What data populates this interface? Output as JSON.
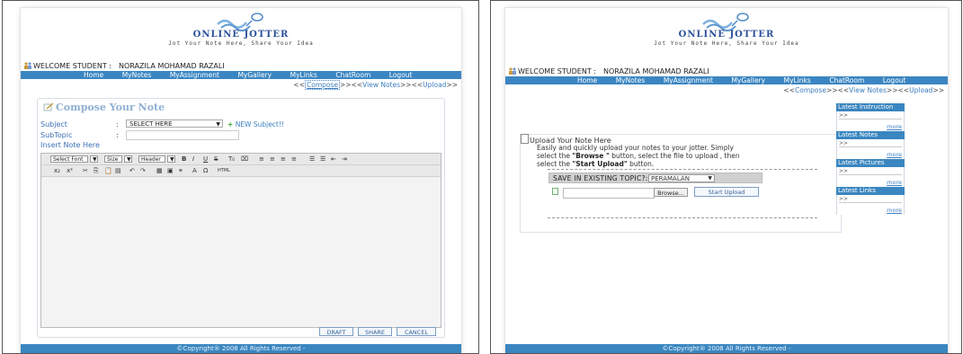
{
  "compose_page": {
    "logo": {
      "title": "ONLINE JOTTER",
      "tagline": "Jot Your Note Here, Share Your Idea"
    },
    "welcome": {
      "label": "WELCOME STUDENT :",
      "name": "NORAZILA MOHAMAD RAZALI"
    },
    "nav": [
      "Home",
      "MyNotes",
      "MyAssignment",
      "MyGallery",
      "MyLinks",
      "ChatRoom",
      "Logout"
    ],
    "breadcrumb": {
      "sep1": "<<",
      "current": "Compose",
      "sep2": ">><<",
      "view": "View Notes",
      "sep3": ">><<",
      "upload": "Upload",
      "sep4": ">>"
    },
    "title": "Compose Your Note",
    "subject_label": "Subject",
    "colon": ":",
    "subject_select": "SELECT HERE",
    "new_subject": "NEW Subject!!",
    "subtopic_label": "SubTopic",
    "insert_label": "Insert Note Here",
    "toolbar": {
      "font": "Select Font",
      "size": "Size",
      "header": "Header",
      "html": "HTML"
    },
    "buttons": {
      "draft": "DRAFT",
      "share": "SHARE",
      "cancel": "CANCEL"
    },
    "footer": "©Copyright® 2008 All Rights Reserved -"
  },
  "upload_page": {
    "logo": {
      "title": "ONLINE JOTTER",
      "tagline": "Jot Your Note Here, Share Your Idea"
    },
    "welcome": {
      "label": "WELCOME STUDENT :",
      "name": "NORAZILA MOHAMAD RAZALI"
    },
    "nav": [
      "Home",
      "MyNotes",
      "MyAssignment",
      "MyGallery",
      "MyLinks",
      "ChatRoom",
      "Logout"
    ],
    "breadcrumb": {
      "sep1": "<<",
      "compose": "Compose",
      "sep2": ">><<",
      "view": "View Notes",
      "sep3": ">><<",
      "upload": "Upload",
      "sep4": ">>"
    },
    "title": "Upload Your Note Here",
    "desc_line1": "Easily and quickly upload your notes to your jotter. Simply",
    "desc_line2a": "select the ",
    "desc_browse": "\"Browse \"",
    "desc_line2b": " button, select the file to upload , then",
    "desc_line3a": "select the ",
    "desc_start": "\"Start Upload\"",
    "desc_line3b": " button.",
    "topic_label": "SAVE IN EXISTING TOPIC?:",
    "topic_value": "PERAMALAN",
    "browse_button": "Browse...",
    "start_button": "Start Upload",
    "sidebar": [
      {
        "title": "Latest Instruction",
        "arrow": ">>",
        "more": "more"
      },
      {
        "title": "Latest Notes",
        "arrow": ">>",
        "more": "more"
      },
      {
        "title": "Latest Pictures",
        "arrow": ">>",
        "more": "more"
      },
      {
        "title": "Latest Links",
        "arrow": ">>",
        "more": "more"
      }
    ],
    "footer": "©Copyright® 2008 All Rights Reserved -"
  },
  "colors": {
    "nav_blue": "#3b86c2",
    "link_blue": "#3d7fc0",
    "logo_blue": "#2b4f9a"
  }
}
